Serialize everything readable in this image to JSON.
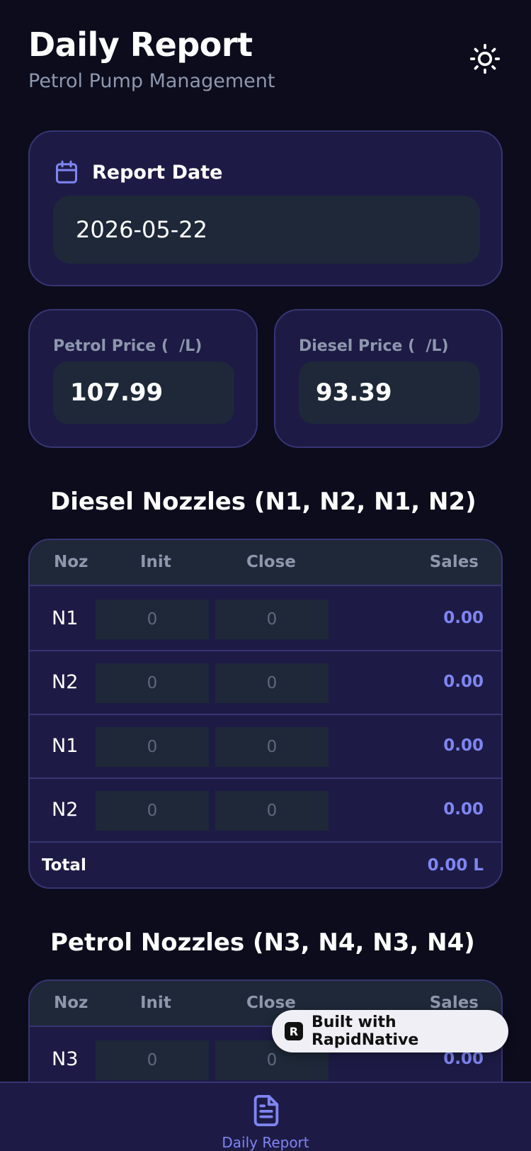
{
  "header": {
    "title": "Daily Report",
    "subtitle": "Petrol Pump Management",
    "theme_icon": "sun-icon"
  },
  "report_date": {
    "icon": "calendar-icon",
    "label": "Report Date",
    "value": "2026-05-22"
  },
  "prices": {
    "petrol": {
      "label": "Petrol Price (  /L)",
      "value": "107.99"
    },
    "diesel": {
      "label": "Diesel Price (  /L)",
      "value": "93.39"
    }
  },
  "table_headers": {
    "noz": "Noz",
    "init": "Init",
    "close": "Close",
    "sales": "Sales"
  },
  "diesel": {
    "title": "Diesel Nozzles (N1, N2, N1, N2)",
    "rows": [
      {
        "noz": "N1",
        "init": "0",
        "close": "0",
        "sales": "0.00"
      },
      {
        "noz": "N2",
        "init": "0",
        "close": "0",
        "sales": "0.00"
      },
      {
        "noz": "N1",
        "init": "0",
        "close": "0",
        "sales": "0.00"
      },
      {
        "noz": "N2",
        "init": "0",
        "close": "0",
        "sales": "0.00"
      }
    ],
    "total_label": "Total",
    "total_value": "0.00 L"
  },
  "petrol": {
    "title": "Petrol Nozzles (N3, N4, N3, N4)",
    "rows": [
      {
        "noz": "N3",
        "init": "0",
        "close": "0",
        "sales": "0.00"
      }
    ]
  },
  "badge": {
    "text": "Built with RapidNative"
  },
  "bottom_nav": {
    "items": [
      {
        "label": "Daily Report",
        "icon": "document-icon"
      }
    ]
  },
  "colors": {
    "background": "#0c0c1d",
    "card": "#1d1b45",
    "card_border": "#373573",
    "input": "#1e2838",
    "accent": "#7f85f2",
    "muted_text": "#8e97ad"
  }
}
